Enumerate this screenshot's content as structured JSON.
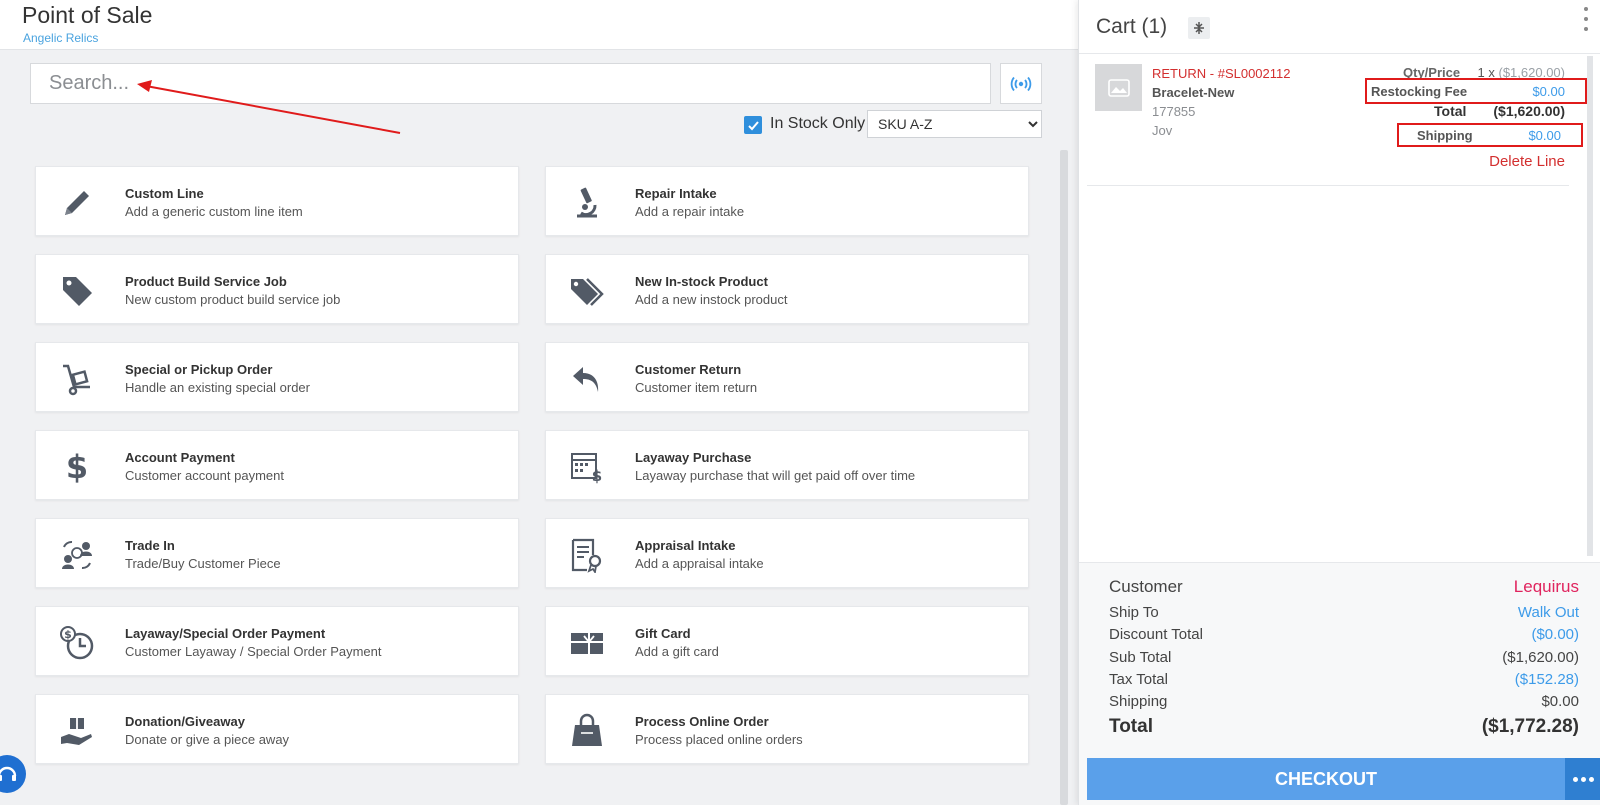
{
  "header": {
    "title": "Point of Sale",
    "subtitle": "Angelic Relics"
  },
  "search": {
    "placeholder": "Search..."
  },
  "filters": {
    "in_stock_label": "In Stock Only",
    "in_stock_checked": true,
    "sort_selected": "SKU A-Z"
  },
  "actions": [
    {
      "title": "Custom Line",
      "subtitle": "Add a generic custom line item",
      "icon": "pencil-icon"
    },
    {
      "title": "Repair Intake",
      "subtitle": "Add a repair intake",
      "icon": "microscope-icon"
    },
    {
      "title": "Product Build Service Job",
      "subtitle": "New custom product build service job",
      "icon": "tag-icon"
    },
    {
      "title": "New In-stock Product",
      "subtitle": "Add a new instock product",
      "icon": "tags-icon"
    },
    {
      "title": "Special or Pickup Order",
      "subtitle": "Handle an existing special order",
      "icon": "hand-truck-icon"
    },
    {
      "title": "Customer Return",
      "subtitle": "Customer item return",
      "icon": "return-arrow-icon"
    },
    {
      "title": "Account Payment",
      "subtitle": "Customer account payment",
      "icon": "dollar-icon"
    },
    {
      "title": "Layaway Purchase",
      "subtitle": "Layaway purchase that will get paid off over time",
      "icon": "calendar-dollar-icon"
    },
    {
      "title": "Trade In",
      "subtitle": "Trade/Buy Customer Piece",
      "icon": "trade-in-icon"
    },
    {
      "title": "Appraisal Intake",
      "subtitle": "Add a appraisal intake",
      "icon": "certificate-icon"
    },
    {
      "title": "Layaway/Special Order Payment",
      "subtitle": "Customer Layaway / Special Order Payment",
      "icon": "clock-dollar-icon"
    },
    {
      "title": "Gift Card",
      "subtitle": "Add a gift card",
      "icon": "gift-card-icon"
    },
    {
      "title": "Donation/Giveaway",
      "subtitle": "Donate or give a piece away",
      "icon": "hand-gift-icon"
    },
    {
      "title": "Process Online Order",
      "subtitle": "Process placed online orders",
      "icon": "shopping-bag-icon"
    }
  ],
  "cart": {
    "title": "Cart (1)",
    "item": {
      "return_label": "RETURN - #SL0002112",
      "name": "Bracelet-New",
      "sku": "177855",
      "staff": "Jov",
      "qty_label": "Qty/Price",
      "qty_prefix": "1 x",
      "qty_price": "($1,620.00)",
      "restocking_label": "Restocking Fee",
      "restocking_value": "$0.00",
      "total_label": "Total",
      "total_value": "($1,620.00)",
      "shipping_label": "Shipping",
      "shipping_value": "$0.00",
      "delete_label": "Delete Line"
    },
    "summary": {
      "customer_label": "Customer",
      "customer_value": "Lequirus",
      "shipto_label": "Ship To",
      "shipto_value": "Walk Out",
      "discount_label": "Discount Total",
      "discount_value": "($0.00)",
      "subtotal_label": "Sub Total",
      "subtotal_value": "($1,620.00)",
      "tax_label": "Tax Total",
      "tax_value": "($152.28)",
      "shipping_label": "Shipping",
      "shipping_value": "$0.00",
      "total_label": "Total",
      "total_value": "($1,772.28)"
    },
    "checkout_label": "CHECKOUT"
  },
  "colors": {
    "accent": "#5aa0ea",
    "link": "#3d9be9",
    "danger": "#d32f2f",
    "annotation": "#e01b1b"
  }
}
